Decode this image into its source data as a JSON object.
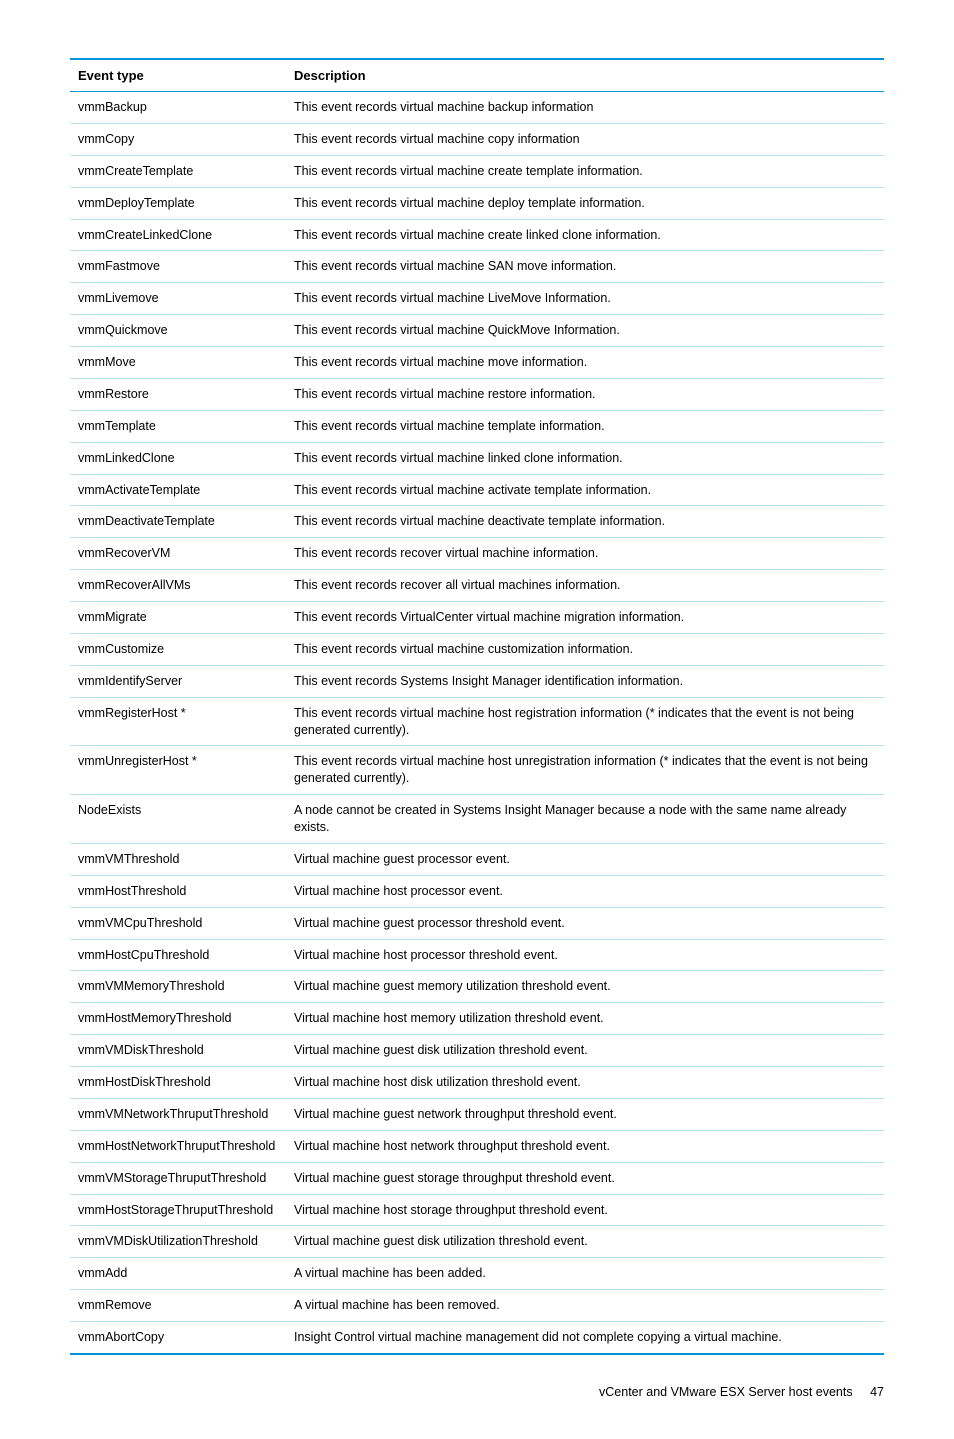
{
  "table": {
    "headers": {
      "col1": "Event type",
      "col2": "Description"
    },
    "rows": [
      {
        "event": "vmmBackup",
        "desc": "This event records virtual machine backup information"
      },
      {
        "event": "vmmCopy",
        "desc": "This event records virtual machine copy information"
      },
      {
        "event": "vmmCreateTemplate",
        "desc": "This event records virtual machine create template information."
      },
      {
        "event": "vmmDeployTemplate",
        "desc": "This event records virtual machine deploy template information."
      },
      {
        "event": "vmmCreateLinkedClone",
        "desc": "This event records virtual machine create linked clone information."
      },
      {
        "event": "vmmFastmove",
        "desc": "This event records virtual machine SAN move information."
      },
      {
        "event": "vmmLivemove",
        "desc": "This event records virtual machine LiveMove Information."
      },
      {
        "event": "vmmQuickmove",
        "desc": "This event records virtual machine QuickMove Information."
      },
      {
        "event": "vmmMove",
        "desc": "This event records virtual machine move information."
      },
      {
        "event": "vmmRestore",
        "desc": "This event records virtual machine restore information."
      },
      {
        "event": "vmmTemplate",
        "desc": "This event records virtual machine template information."
      },
      {
        "event": "vmmLinkedClone",
        "desc": "This event records virtual machine linked clone information."
      },
      {
        "event": "vmmActivateTemplate",
        "desc": "This event records virtual machine activate template information."
      },
      {
        "event": "vmmDeactivateTemplate",
        "desc": "This event records virtual machine deactivate template information."
      },
      {
        "event": "vmmRecoverVM",
        "desc": "This event records recover virtual machine information."
      },
      {
        "event": "vmmRecoverAllVMs",
        "desc": "This event records recover all virtual machines information."
      },
      {
        "event": "vmmMigrate",
        "desc": "This event records VirtualCenter virtual machine migration information."
      },
      {
        "event": "vmmCustomize",
        "desc": "This event records virtual machine customization information."
      },
      {
        "event": "vmmIdentifyServer",
        "desc": "This event records Systems Insight Manager identification information."
      },
      {
        "event": "vmmRegisterHost *",
        "desc": "This event records virtual machine host registration information (* indicates that the event is not being generated currently)."
      },
      {
        "event": "vmmUnregisterHost *",
        "desc": "This event records virtual machine host unregistration information (* indicates that the event is not being generated currently)."
      },
      {
        "event": "NodeExists",
        "desc": "A node cannot be created in Systems Insight Manager because a node with the same name already exists."
      },
      {
        "event": "vmmVMThreshold",
        "desc": "Virtual machine guest processor event."
      },
      {
        "event": "vmmHostThreshold",
        "desc": "Virtual machine host processor event."
      },
      {
        "event": "vmmVMCpuThreshold",
        "desc": "Virtual machine guest processor threshold event."
      },
      {
        "event": "vmmHostCpuThreshold",
        "desc": "Virtual machine host processor threshold event."
      },
      {
        "event": "vmmVMMemoryThreshold",
        "desc": "Virtual machine guest memory utilization threshold event."
      },
      {
        "event": "vmmHostMemoryThreshold",
        "desc": "Virtual machine host memory utilization threshold event."
      },
      {
        "event": "vmmVMDiskThreshold",
        "desc": "Virtual machine guest disk utilization threshold event."
      },
      {
        "event": "vmmHostDiskThreshold",
        "desc": "Virtual machine host disk utilization threshold event."
      },
      {
        "event": "vmmVMNetworkThruputThreshold",
        "desc": "Virtual machine guest network throughput threshold event."
      },
      {
        "event": "vmmHostNetworkThruputThreshold",
        "desc": "Virtual machine host network throughput threshold event."
      },
      {
        "event": "vmmVMStorageThruputThreshold",
        "desc": "Virtual machine guest storage throughput threshold event."
      },
      {
        "event": "vmmHostStorageThruputThreshold",
        "desc": "Virtual machine host storage throughput threshold event."
      },
      {
        "event": "vmmVMDiskUtilizationThreshold",
        "desc": "Virtual machine guest disk utilization threshold event."
      },
      {
        "event": "vmmAdd",
        "desc": "A virtual machine has been added."
      },
      {
        "event": "vmmRemove",
        "desc": "A virtual machine has been removed."
      },
      {
        "event": "vmmAbortCopy",
        "desc": "Insight Control virtual machine management did not complete copying a virtual machine."
      }
    ]
  },
  "footer": {
    "title": "vCenter and VMware ESX Server host events",
    "page": "47"
  }
}
